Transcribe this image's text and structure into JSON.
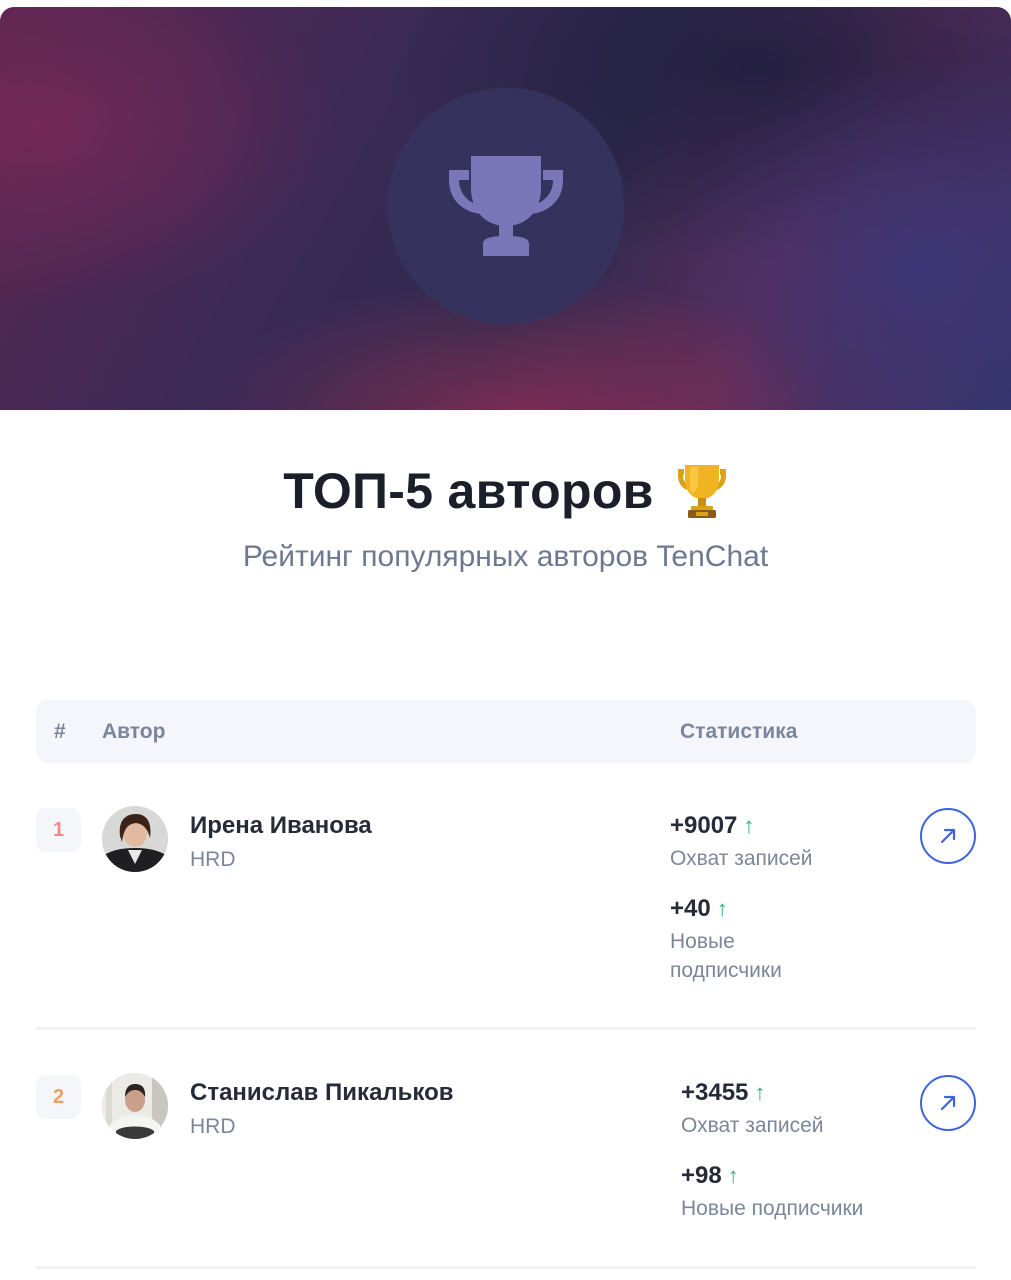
{
  "header": {
    "title": "ТОП-5 авторов",
    "title_emoji": "trophy-emoji",
    "subtitle": "Рейтинг популярных авторов TenChat"
  },
  "table": {
    "columns": {
      "num": "#",
      "author": "Автор",
      "stats": "Статистика"
    },
    "rows": [
      {
        "rank": "1",
        "rank_color": "#f08a8a",
        "name": "Ирена Иванова",
        "role": "HRD",
        "reach_value": "+9007",
        "reach_label": "Охват записей",
        "subs_value": "+40",
        "subs_label_1": "Новые",
        "subs_label_2": "подписчики"
      },
      {
        "rank": "2",
        "rank_color": "#f2a05a",
        "name": "Станислав Пикальков",
        "role": "HRD",
        "reach_value": "+3455",
        "reach_label": "Охват записей",
        "subs_value": "+98",
        "subs_label": "Новые подписчики"
      }
    ]
  },
  "colors": {
    "accent": "#3d63dd",
    "up_arrow": "#2bb673",
    "trophy_circle": "#35335e",
    "trophy_icon": "#7b76b8"
  },
  "icons": {
    "banner": "trophy-icon",
    "trend": "arrow-up-icon",
    "open": "arrow-up-right-icon"
  }
}
